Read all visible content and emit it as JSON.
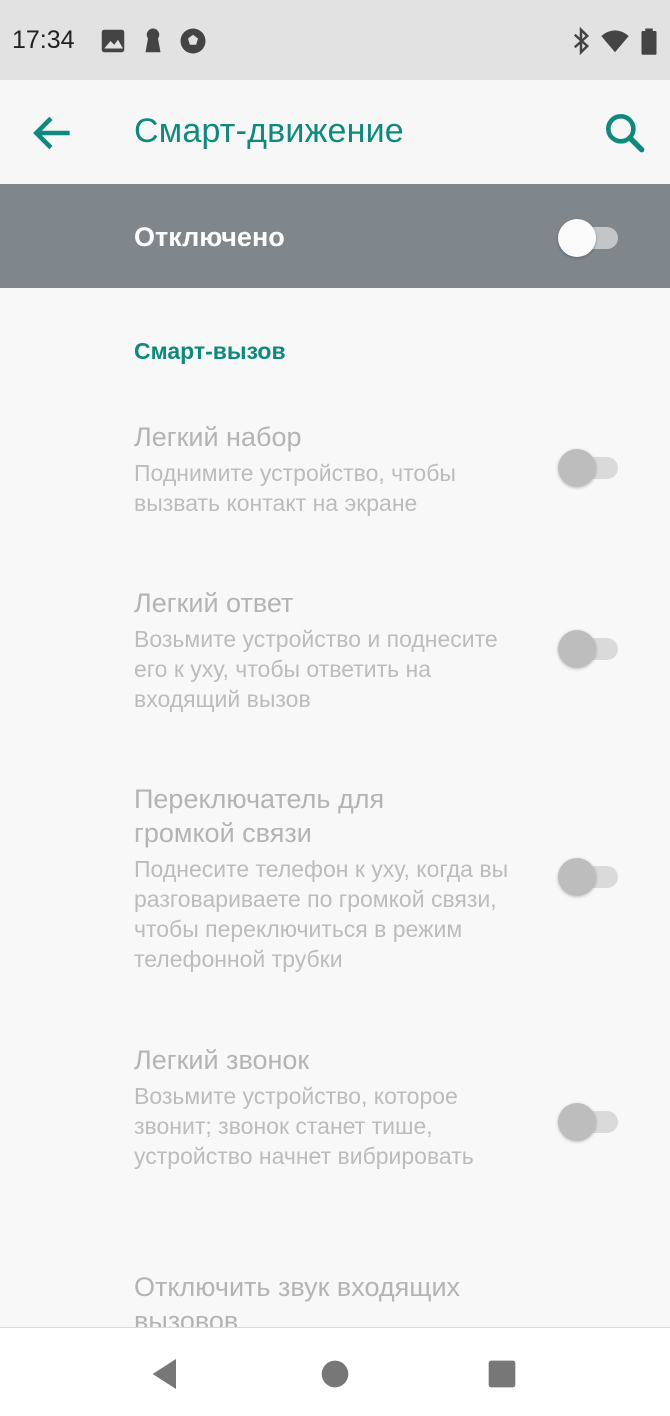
{
  "status_bar": {
    "time": "17:34",
    "left_icons": [
      "image-icon",
      "keyhole-icon",
      "soccer-ball-icon"
    ],
    "right_icons": [
      "bluetooth-icon",
      "wifi-icon",
      "battery-icon"
    ]
  },
  "app_bar": {
    "title": "Смарт-движение",
    "back_icon": "arrow-back-icon",
    "search_icon": "search-icon"
  },
  "master_switch": {
    "label": "Отключено",
    "on": false
  },
  "section": {
    "header": "Смарт-вызов"
  },
  "prefs": [
    {
      "title": "Легкий набор",
      "summary": "Поднимите устройство, чтобы вызвать контакт на экране",
      "on": false,
      "enabled": false
    },
    {
      "title": "Легкий ответ",
      "summary": "Возьмите устройство и поднесите его к уху, чтобы ответить на входящий вызов",
      "on": false,
      "enabled": false
    },
    {
      "title": "Переключатель для громкой связи",
      "summary": "Поднесите телефон к уху, когда вы разговариваете по громкой связи, чтобы переключиться в режим телефонной трубки",
      "on": false,
      "enabled": false
    },
    {
      "title": "Легкий звонок",
      "summary": "Возьмите устройство, которое звонит; звонок станет тише, устройство начнет вибрировать",
      "on": false,
      "enabled": false
    },
    {
      "title": "Отключить звук входящих вызовов",
      "enabled": false
    }
  ],
  "nav_bar": {
    "icons": [
      "nav-back-icon",
      "nav-home-icon",
      "nav-recents-icon"
    ]
  },
  "colors": {
    "accent": "#0d8a7e",
    "master_bar": "#7f878d",
    "disabled_text": "#b4b4b4",
    "status_bar": "#e2e2e2"
  }
}
